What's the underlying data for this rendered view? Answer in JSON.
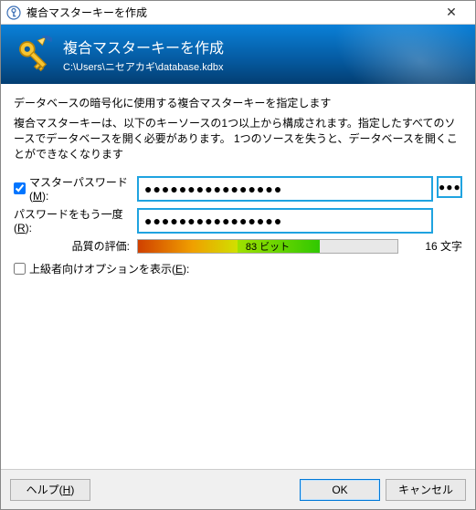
{
  "window": {
    "title": "複合マスターキーを作成",
    "close_glyph": "✕"
  },
  "banner": {
    "title": "複合マスターキーを作成",
    "subtitle": "C:\\Users\\ニセアカギ\\database.kdbx"
  },
  "body": {
    "desc1": "データベースの暗号化に使用する複合マスターキーを指定します",
    "desc2": "複合マスターキーは、以下のキーソースの1つ以上から構成されます。指定したすべてのソースでデータベースを開く必要があります。 1つのソースを失うと、データベースを開くことができなくなります",
    "master_pw_label": "マスターパスワード(M):",
    "repeat_pw_label": "パスワードをもう一度(R):",
    "quality_label": "品質の評価:",
    "bits_label": "83 ビット",
    "chars_label": "16 文字",
    "expert_label": "上級者向けオプションを表示(E):",
    "pw_value": "●●●●●●●●●●●●●●●●",
    "pw_repeat_value": "●●●●●●●●●●●●●●●●",
    "reveal_glyph": "●●●",
    "master_pw_checked": true,
    "expert_checked": false
  },
  "footer": {
    "help": "ヘルプ(H)",
    "ok": "OK",
    "cancel": "キャンセル"
  },
  "colors": {
    "accent": "#1fa3e0",
    "banner_top": "#0a80d8",
    "banner_bottom": "#033e72"
  }
}
